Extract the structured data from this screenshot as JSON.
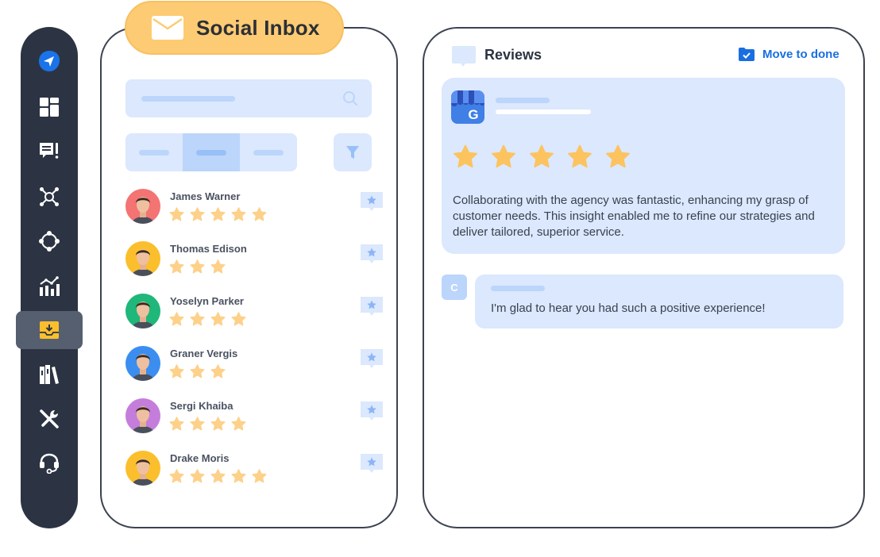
{
  "app": {
    "title": "Social Inbox"
  },
  "sidebar": {
    "items": [
      {
        "icon": "send-icon",
        "label": "Logo",
        "active": false
      },
      {
        "icon": "dashboard-grid-icon",
        "label": "Dashboard",
        "active": false
      },
      {
        "icon": "feedback-icon",
        "label": "Feedback",
        "active": false
      },
      {
        "icon": "network-hub-icon",
        "label": "Network",
        "active": false
      },
      {
        "icon": "nodes-icon",
        "label": "Connections",
        "active": false
      },
      {
        "icon": "analytics-chart-icon",
        "label": "Analytics",
        "active": false
      },
      {
        "icon": "inbox-tray-icon",
        "label": "Inbox",
        "active": true
      },
      {
        "icon": "library-books-icon",
        "label": "Library",
        "active": false
      },
      {
        "icon": "tools-icon",
        "label": "Tools",
        "active": false
      },
      {
        "icon": "headset-support-icon",
        "label": "Support",
        "active": false
      }
    ]
  },
  "inbox": {
    "search": {
      "placeholder": "",
      "icon": "search-icon"
    },
    "tabs": [
      {
        "label": "",
        "active": false
      },
      {
        "label": "",
        "active": true
      },
      {
        "label": "",
        "active": false
      }
    ],
    "filter_icon": "filter-funnel-icon",
    "contacts": [
      {
        "name": "James Warner",
        "rating": 5,
        "avatar_bg": "#f47373"
      },
      {
        "name": "Thomas Edison",
        "rating": 3,
        "avatar_bg": "#fbbf2d"
      },
      {
        "name": "Yoselyn Parker",
        "rating": 4,
        "avatar_bg": "#1fb77a"
      },
      {
        "name": "Graner Vergis",
        "rating": 3,
        "avatar_bg": "#3b8ef0"
      },
      {
        "name": "Sergi Khaiba",
        "rating": 4,
        "avatar_bg": "#c57ddb"
      },
      {
        "name": "Drake Moris",
        "rating": 5,
        "avatar_bg": "#fbbf2d"
      }
    ]
  },
  "reviews": {
    "title": "Reviews",
    "move_to_done": "Move to done",
    "card": {
      "source_icon": "google-my-business-icon",
      "rating": 5,
      "text": "Collaborating with the agency was fantastic, enhancing my grasp of customer needs. This insight enabled me to refine our strategies and deliver tailored, superior service."
    },
    "reply": {
      "avatar_initial": "C",
      "text": "I'm glad to hear you had such a positive experience!"
    }
  },
  "colors": {
    "sidebar_bg": "#2c3443",
    "accent_yellow": "#fdcb73",
    "star": "#fcc35f",
    "light_blue": "#dbe8fd",
    "link_blue": "#1a6fe0"
  }
}
